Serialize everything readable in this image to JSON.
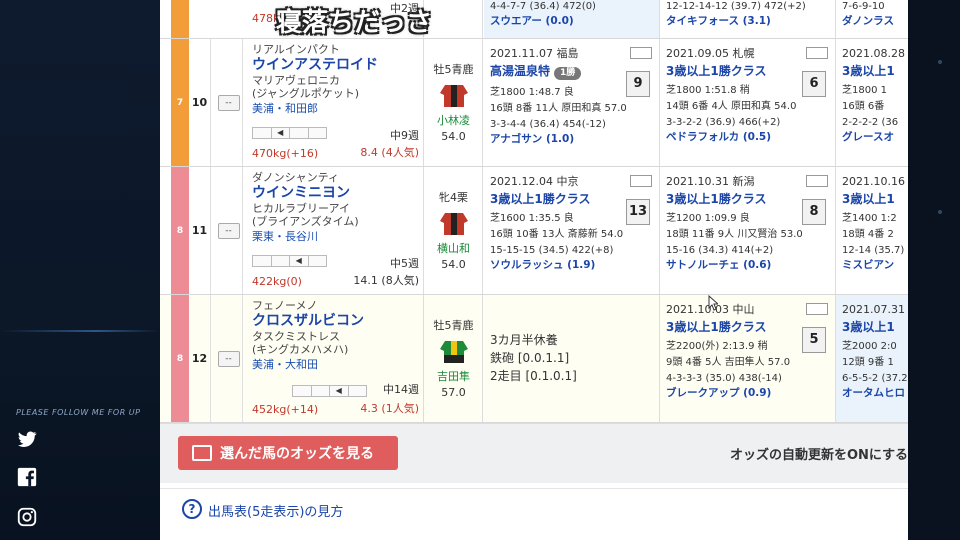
{
  "overlay": {
    "title": "寝落ちだっさ"
  },
  "sidebar": {
    "follow_text": "PLEASE FOLLOW ME FOR UP",
    "icons": [
      "twitter-icon",
      "facebook-icon",
      "instagram-icon"
    ]
  },
  "partial_row": {
    "weeks": "中2週",
    "weight": "478kg(",
    "race1": {
      "passing": "4-4-7-7 (36.4) 472(0)",
      "winner": "スウエアー (0.0)"
    },
    "race2": {
      "passing": "12-12-14-12 (39.7) 472(+2)",
      "winner": "タイキフォース (3.1)"
    },
    "race3": {
      "passing": "7-6-9-10",
      "winner": "ダノンラス"
    }
  },
  "horses": [
    {
      "waku": "7",
      "waku_color": "#f39c3a",
      "number": "10",
      "mark": "--",
      "sire": "リアルインパクト",
      "name": "ウインアステロイド",
      "dam": "マリアヴェロニカ",
      "dam_sire": "(ジャングルポケット)",
      "trainer": "美浦・和田郎",
      "weeks": "中9週",
      "weight": "470kg(+16)",
      "odds": "8.4 (4人気)",
      "sex_age": "牡5青鹿",
      "jockey": "小林凌",
      "kg": "54.0",
      "races": [
        {
          "date": "2021.11.07 福島",
          "name": "高湯温泉特",
          "grade": "1勝",
          "rank": "9",
          "cond": "芝1800 1:48.7 良",
          "detail": "16頭 8番 11人 原田和真 57.0",
          "passing": "3-3-4-4 (36.4) 454(-12)",
          "winner": "アナゴサン (1.0)"
        },
        {
          "date": "2021.09.05 札幌",
          "name": "3歳以上1勝クラス",
          "rank": "6",
          "cond": "芝1800 1:51.8 稍",
          "detail": "14頭 6番 4人 原田和真 54.0",
          "passing": "3-3-2-2 (36.9) 466(+2)",
          "winner": "ペドラフォルカ (0.5)"
        },
        {
          "date": "2021.08.28",
          "name": "3歳以上1",
          "cond": "芝1800 1",
          "detail": "16頭 6番",
          "passing": "2-2-2-2 (36",
          "winner": "グレースオ"
        }
      ]
    },
    {
      "waku": "8",
      "waku_color": "#ee8c96",
      "number": "11",
      "mark": "--",
      "sire": "ダノンシャンティ",
      "name": "ウインミニヨン",
      "dam": "ヒカルラブリーアイ",
      "dam_sire": "(ブライアンズタイム)",
      "trainer": "栗東・長谷川",
      "weeks": "中5週",
      "weight": "422kg(0)",
      "odds": "14.1 (8人気)",
      "sex_age": "牝4栗",
      "jockey": "横山和",
      "kg": "54.0",
      "races": [
        {
          "date": "2021.12.04 中京",
          "name": "3歳以上1勝クラス",
          "rank": "13",
          "cond": "芝1600 1:35.5 良",
          "detail": "16頭 10番 13人 斎藤新 54.0",
          "passing": "15-15-15 (34.5) 422(+8)",
          "winner": "ソウルラッシュ (1.9)"
        },
        {
          "date": "2021.10.31 新潟",
          "name": "3歳以上1勝クラス",
          "rank": "8",
          "cond": "芝1200 1:09.9 良",
          "detail": "18頭 11番 9人 川又賢治 53.0",
          "passing": "15-16 (34.3) 414(+2)",
          "winner": "サトノルーチェ (0.6)"
        },
        {
          "date": "2021.10.16",
          "name": "3歳以上1",
          "cond": "芝1400 1:2",
          "detail": "18頭 4番 2",
          "passing": "12-14 (35.7)",
          "winner": "ミスビアン"
        }
      ]
    },
    {
      "waku": "8",
      "waku_color": "#ee8c96",
      "number": "12",
      "mark": "--",
      "sire": "フェノーメノ",
      "name": "クロスザルビコン",
      "dam": "タスクミストレス",
      "dam_sire": "(キングカメハメハ)",
      "trainer": "美浦・大和田",
      "weeks": "中14週",
      "weight": "452kg(+14)",
      "odds": "4.3 (1人気)",
      "sex_age": "牡5青鹿",
      "jockey": "吉田隼",
      "kg": "57.0",
      "rest": {
        "title": "3カ月半休養",
        "line1": "鉄砲 [0.0.1.1]",
        "line2": "2走目 [0.1.0.1]"
      },
      "races": [
        {
          "date": "2021.10.03 中山",
          "name": "3歳以上1勝クラス",
          "rank": "5",
          "cond": "芝2200(外) 2:13.9 稍",
          "detail": "9頭 4番 5人 吉田隼人 57.0",
          "passing": "4-3-3-3 (35.0) 438(-14)",
          "winner": "ブレークアップ (0.9)"
        },
        {
          "date": "2021.07.31",
          "name": "3歳以上1",
          "cond": "芝2000 2:0",
          "detail": "12頭 9番 1",
          "passing": "6-5-5-2 (37.2",
          "winner": "オータムヒロ"
        }
      ]
    }
  ],
  "bottom": {
    "odds_button": "選んだ馬のオッズを見る",
    "auto_update": "オッズの自動更新をONにする",
    "help_link": "出馬表(5走表示)の見方"
  }
}
